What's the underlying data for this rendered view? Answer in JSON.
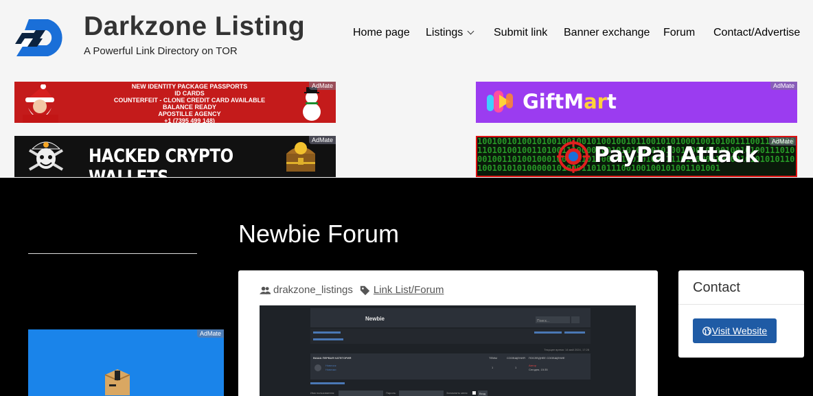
{
  "header": {
    "site_title": "Darkzone Listing",
    "tagline": "A Powerful Link Directory on TOR",
    "nav": [
      {
        "label": "Home page"
      },
      {
        "label": "Listings",
        "has_dropdown": true
      },
      {
        "label": "Submit link"
      },
      {
        "label": "Banner exchange"
      },
      {
        "label": "Forum"
      },
      {
        "label": "Contact/Advertise"
      }
    ]
  },
  "ads": {
    "badge": "AdMate",
    "christmas": {
      "lines": [
        "NEW IDENTITY PACKAGE PASSPORTS",
        "ID CARDS",
        "COUNTERFEIT - CLONE CREDIT CARD AVAILABLE",
        "BALANCE READY",
        "APOSTILLE AGENCY",
        "+1 (7395 499 148)"
      ]
    },
    "giftmart": {
      "text_main": "GiftM",
      "text_accent": "ar",
      "text_end": "t"
    },
    "hacked": {
      "text": "HACKED CRYPTO WALLETS"
    },
    "paypal": {
      "text": "PayPal Attack",
      "binary": "1001001010010100100100101001001011001010100010010100111001110000110101001001101001110000100101010010101001000101001001010011101000100110100100010010110100010100101000111011000010000101010101101001010101000001010001101011100100100101001101001"
    }
  },
  "main": {
    "title": "Newbie Forum",
    "author": "drakzone_listings",
    "category": "Link List/Forum",
    "screenshot": {
      "forum_title": "Newbie",
      "search_placeholder": "Поиск...",
      "section_header": "ВАША ПЕРВАЯ КАТЕГОРИЯ",
      "col_topics": "ТЕМЫ",
      "col_posts": "СООБЩЕНИЯ",
      "col_last": "ПОСЛЕДНЕЕ СООБЩЕНИЕ",
      "forum_name": "Новичок",
      "forum_desc": "Новички",
      "topics": "1",
      "posts": "1",
      "last_by": "Автор",
      "last_when": "Сегодня, 15:35",
      "time_now": "Текущее время: 14 май 2024, 17:28",
      "login_user": "Имя пользователя:",
      "login_pass": "Пароль:",
      "remember": "Запомнить меня",
      "login_btn": "Вход"
    }
  },
  "contact": {
    "title": "Contact",
    "button_label": "Visit Website"
  },
  "colors": {
    "header_bg": "#f5f5f5",
    "page_bg": "#000000",
    "button": "#1f5ba5",
    "logo_blue": "#1a6fd8"
  }
}
